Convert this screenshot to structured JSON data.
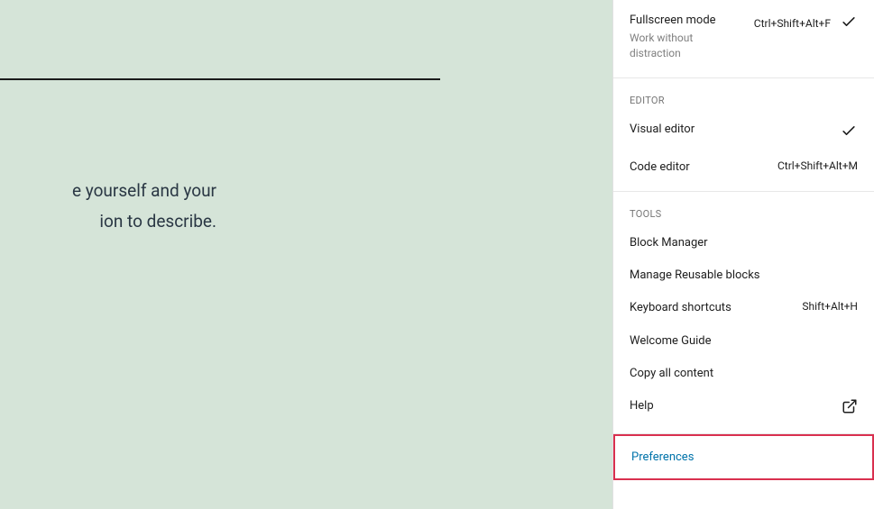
{
  "editor": {
    "text_line1": "e yourself and your",
    "text_line2": "ion to describe."
  },
  "menu": {
    "view": {
      "fullscreen": {
        "title": "Fullscreen mode",
        "desc": "Work without distraction",
        "shortcut": "Ctrl+Shift+Alt+F"
      }
    },
    "editor_section": {
      "label": "Editor",
      "visual": {
        "title": "Visual editor"
      },
      "code": {
        "title": "Code editor",
        "shortcut": "Ctrl+Shift+Alt+M"
      }
    },
    "tools_section": {
      "label": "Tools",
      "block_manager": {
        "title": "Block Manager"
      },
      "reusable": {
        "title": "Manage Reusable blocks"
      },
      "keyboard": {
        "title": "Keyboard shortcuts",
        "shortcut": "Shift+Alt+H"
      },
      "welcome": {
        "title": "Welcome Guide"
      },
      "copy_all": {
        "title": "Copy all content"
      },
      "help": {
        "title": "Help"
      }
    },
    "preferences": {
      "title": "Preferences"
    }
  }
}
